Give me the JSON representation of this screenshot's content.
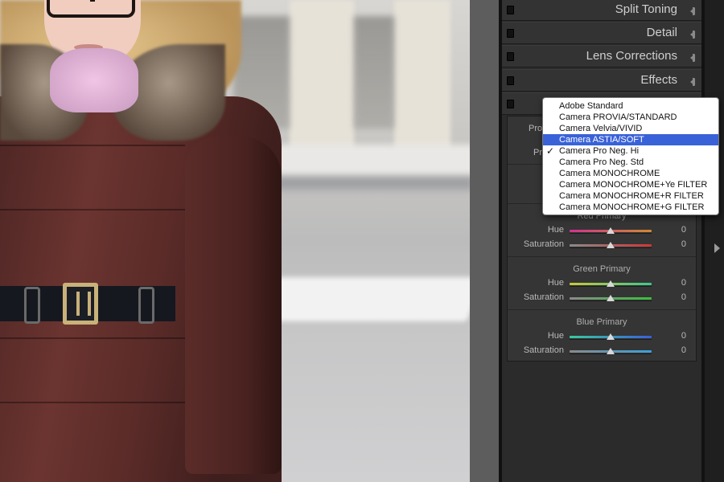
{
  "panel": {
    "sections": [
      {
        "title": "Split Toning"
      },
      {
        "title": "Detail"
      },
      {
        "title": "Lens Corrections"
      },
      {
        "title": "Effects"
      }
    ],
    "calibration": {
      "profile_label_partial": "Pro",
      "process_label_partial": "Pr",
      "groups": [
        {
          "title": "Red Primary",
          "hue": {
            "label": "Hue",
            "value": "0"
          },
          "saturation": {
            "label": "Saturation",
            "value": "0"
          }
        },
        {
          "title": "Green Primary",
          "hue": {
            "label": "Hue",
            "value": "0"
          },
          "saturation": {
            "label": "Saturation",
            "value": "0"
          }
        },
        {
          "title": "Blue Primary",
          "hue": {
            "label": "Hue",
            "value": "0"
          },
          "saturation": {
            "label": "Saturation",
            "value": "0"
          }
        }
      ]
    }
  },
  "dropdown": {
    "items": [
      {
        "label": "Adobe Standard",
        "checked": false,
        "highlighted": false
      },
      {
        "label": "Camera PROVIA/STANDARD",
        "checked": false,
        "highlighted": false
      },
      {
        "label": "Camera Velvia/VIVID",
        "checked": false,
        "highlighted": false
      },
      {
        "label": "Camera ASTIA/SOFT",
        "checked": false,
        "highlighted": true
      },
      {
        "label": "Camera Pro Neg. Hi",
        "checked": true,
        "highlighted": false
      },
      {
        "label": "Camera Pro Neg. Std",
        "checked": false,
        "highlighted": false
      },
      {
        "label": "Camera MONOCHROME",
        "checked": false,
        "highlighted": false
      },
      {
        "label": "Camera MONOCHROME+Ye FILTER",
        "checked": false,
        "highlighted": false
      },
      {
        "label": "Camera MONOCHROME+R FILTER",
        "checked": false,
        "highlighted": false
      },
      {
        "label": "Camera MONOCHROME+G FILTER",
        "checked": false,
        "highlighted": false
      }
    ],
    "check_glyph": "✓"
  },
  "colors": {
    "highlight": "#3a62d8",
    "panel_bg": "#2b2b2b",
    "red_hue_track": [
      "#d0338f",
      "#d08a30"
    ],
    "red_sat_track": [
      "#8a8a8a",
      "#d03636"
    ],
    "green_hue_track": [
      "#c9c83a",
      "#3ac98a"
    ],
    "green_sat_track": [
      "#8a8a8a",
      "#36c03a"
    ],
    "blue_hue_track": [
      "#3ac9a0",
      "#3a60d8"
    ],
    "blue_sat_track": [
      "#8a8a8a",
      "#3aa0d8"
    ]
  }
}
